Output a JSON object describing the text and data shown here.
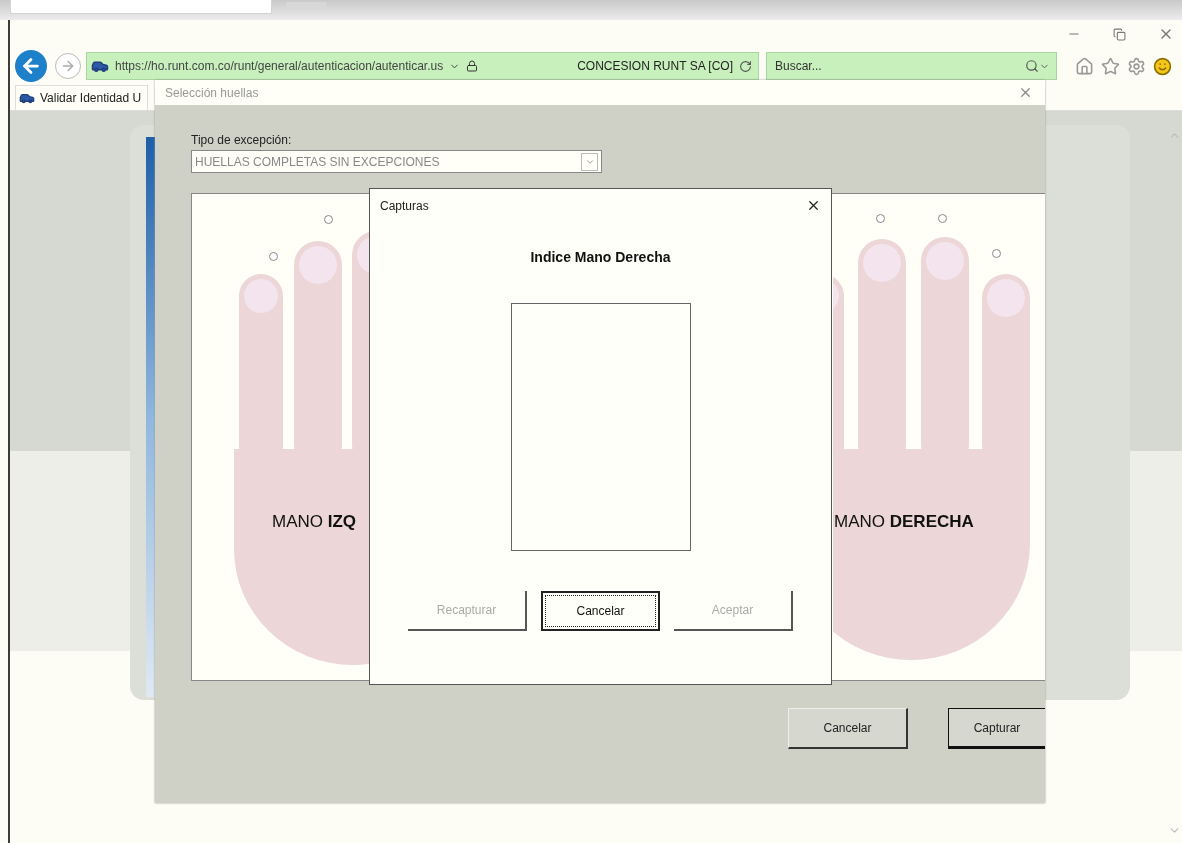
{
  "browser": {
    "address_bar": {
      "url": "https://ho.runt.com.co/runt/general/autenticacion/autenticar.us",
      "certificate": "CONCESION RUNT SA [CO]"
    },
    "search": {
      "placeholder": "Buscar..."
    },
    "tabs": [
      {
        "label": "Validar Identidad U",
        "selected": true
      }
    ]
  },
  "fingerprint_dialog": {
    "title": "Selección huellas",
    "exception_label": "Tipo de excepción:",
    "exception_value": "HUELLAS COMPLETAS SIN EXCEPCIONES",
    "hands": [
      {
        "kind": "left",
        "label": "MANO **IZQ**",
        "fingers": [
          {
            "selected": false
          },
          {
            "selected": false
          }
        ]
      },
      {
        "kind": "right",
        "label": "MANO **DERECHA**",
        "fingers": [
          {
            "selected": false
          },
          {
            "selected": false
          },
          {
            "selected": false
          }
        ]
      }
    ],
    "buttons": [
      {
        "label": "Cancelar",
        "default": false
      },
      {
        "label": "Capturar",
        "default": true
      }
    ]
  },
  "capture_dialog": {
    "title": "Capturas",
    "heading": "Indice Mano Derecha",
    "buttons": [
      {
        "label": "Recapturar",
        "disabled": true,
        "focused": false
      },
      {
        "label": "Cancelar",
        "disabled": false,
        "focused": true
      },
      {
        "label": "Aceptar",
        "disabled": true,
        "focused": false
      }
    ]
  }
}
